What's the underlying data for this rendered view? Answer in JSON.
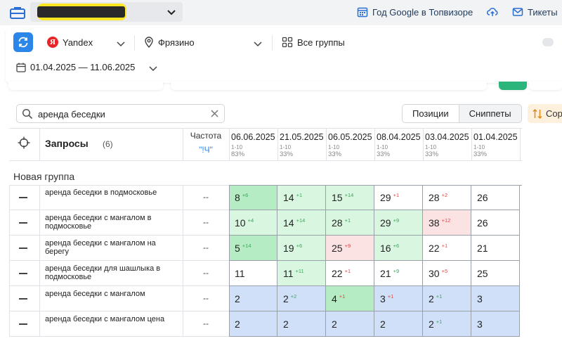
{
  "topbar": {
    "links": [
      {
        "label": "Год Google в Топвизоре",
        "icon": "calendar-grid-icon"
      },
      {
        "label": "",
        "icon": "cloud-upload-icon"
      },
      {
        "label": "Тикеты",
        "icon": "mail-icon"
      }
    ]
  },
  "filters": {
    "engine": "Yandex",
    "region": "Фрязино",
    "groups": "Все группы",
    "date_range": "01.04.2025 — 11.06.2025"
  },
  "search": {
    "value": "аренда беседки",
    "placeholder": ""
  },
  "view_tabs": [
    "Позиции",
    "Сниппеты"
  ],
  "sort_label": "Сор",
  "table": {
    "header_title": "Запросы",
    "header_count": "(6)",
    "freq_label": "Частота",
    "freq_sub": "\"!Ч\"",
    "dates": [
      {
        "date": "06.06.2025",
        "range": "1-10",
        "pct": "83%"
      },
      {
        "date": "21.05.2025",
        "range": "1-10",
        "pct": "33%"
      },
      {
        "date": "06.05.2025",
        "range": "1-10",
        "pct": "33%"
      },
      {
        "date": "08.04.2025",
        "range": "1-10",
        "pct": "33%"
      },
      {
        "date": "03.04.2025",
        "range": "1-10",
        "pct": "33%"
      },
      {
        "date": "01.04.2025",
        "range": "1-10",
        "pct": "33%"
      }
    ],
    "group_name": "Новая группа",
    "rows": [
      {
        "query": "аренда беседки в подмосковье",
        "freq": "--",
        "cells": [
          {
            "v": "8",
            "d": "+6",
            "bg": "g"
          },
          {
            "v": "14",
            "d": "+1",
            "bg": "lg"
          },
          {
            "v": "15",
            "d": "+14",
            "bg": "lg"
          },
          {
            "v": "29",
            "d": "+1",
            "dir": "down",
            "bg": "w"
          },
          {
            "v": "28",
            "d": "+2",
            "dir": "down",
            "bg": "w"
          },
          {
            "v": "26",
            "d": "",
            "bg": "w"
          }
        ]
      },
      {
        "query": "аренда беседки с мангалом в подмосковье",
        "freq": "--",
        "cells": [
          {
            "v": "10",
            "d": "+4",
            "bg": "lg"
          },
          {
            "v": "14",
            "d": "+14",
            "bg": "lg"
          },
          {
            "v": "28",
            "d": "+1",
            "bg": "lg"
          },
          {
            "v": "29",
            "d": "+9",
            "bg": "lg"
          },
          {
            "v": "38",
            "d": "+12",
            "dir": "down",
            "bg": "r"
          },
          {
            "v": "26",
            "d": "",
            "bg": "w"
          }
        ]
      },
      {
        "query": "аренда беседки с мангалом на берегу",
        "freq": "--",
        "cells": [
          {
            "v": "5",
            "d": "+14",
            "bg": "g"
          },
          {
            "v": "19",
            "d": "+6",
            "bg": "lg"
          },
          {
            "v": "25",
            "d": "+9",
            "dir": "down",
            "bg": "r"
          },
          {
            "v": "16",
            "d": "+6",
            "bg": "lg"
          },
          {
            "v": "22",
            "d": "+1",
            "dir": "down",
            "bg": "w"
          },
          {
            "v": "21",
            "d": "",
            "bg": "w"
          }
        ]
      },
      {
        "query": "аренда беседки для шашлыка в подмосковье",
        "freq": "--",
        "cells": [
          {
            "v": "11",
            "d": "",
            "bg": "w"
          },
          {
            "v": "11",
            "d": "+11",
            "bg": "lg"
          },
          {
            "v": "22",
            "d": "+1",
            "dir": "down",
            "bg": "w"
          },
          {
            "v": "21",
            "d": "+9",
            "bg": "w"
          },
          {
            "v": "30",
            "d": "+5",
            "dir": "down",
            "bg": "w"
          },
          {
            "v": "25",
            "d": "",
            "bg": "w"
          }
        ]
      },
      {
        "query": "аренда беседки с мангалом",
        "freq": "--",
        "cells": [
          {
            "v": "2",
            "d": "",
            "bg": "b"
          },
          {
            "v": "2",
            "d": "+2",
            "bg": "b"
          },
          {
            "v": "4",
            "d": "+1",
            "dir": "down",
            "bg": "g"
          },
          {
            "v": "3",
            "d": "+1",
            "dir": "down",
            "bg": "b"
          },
          {
            "v": "2",
            "d": "+1",
            "bg": "b"
          },
          {
            "v": "3",
            "d": "",
            "bg": "b"
          }
        ]
      },
      {
        "query": "аренда беседки с мангалом цена",
        "freq": "--",
        "cells": [
          {
            "v": "2",
            "d": "",
            "bg": "b"
          },
          {
            "v": "2",
            "d": "",
            "bg": "b"
          },
          {
            "v": "2",
            "d": "",
            "bg": "b"
          },
          {
            "v": "2",
            "d": "",
            "bg": "b"
          },
          {
            "v": "2",
            "d": "+1",
            "bg": "b"
          },
          {
            "v": "3",
            "d": "",
            "bg": "b"
          }
        ]
      }
    ]
  },
  "colors": {
    "accent": "#2a86e8",
    "green_strong": "#b6ecc4",
    "green_light": "#d9f6e1",
    "red_light": "#fbe3e3",
    "blue": "#cfe0f8",
    "white": "#ffffff"
  }
}
